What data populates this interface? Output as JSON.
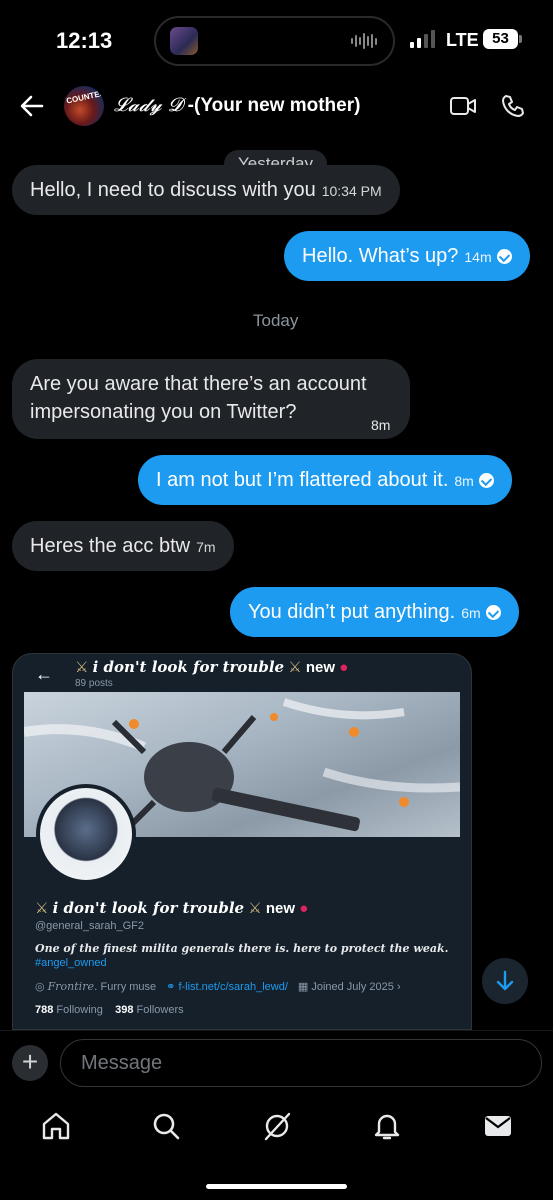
{
  "status": {
    "time": "12:13",
    "network": "LTE",
    "battery": "53"
  },
  "header": {
    "name_fancy": "𝓛𝓪𝓭𝔂 𝓓",
    "name_rest": " -(Your new mother)",
    "avatar_text": "COUNTESS"
  },
  "messages": {
    "day_yesterday": "Yesterday",
    "day_today": "Today",
    "m1": {
      "text": "Hello, I need to discuss with you",
      "time": "10:34 PM"
    },
    "m2": {
      "text": "Hello. What’s up?",
      "time": "14m"
    },
    "m3": {
      "line1": "Are you aware that there’s an account",
      "line2": "impersonating you on Twitter?",
      "time": "8m"
    },
    "m4": {
      "text": "I am not but I’m flattered about it.",
      "time": "8m"
    },
    "m5": {
      "text": "Heres the acc btw",
      "time": "7m"
    },
    "m6": {
      "text": "You didn’t put anything.",
      "time": "6m"
    }
  },
  "shared_profile": {
    "title_fancy": "𝒊 𝒅𝒐𝒏'𝒕 𝒍𝒐𝒐𝒌 𝒇𝒐𝒓 𝒕𝒓𝒐𝒖𝒃𝒍𝒆",
    "title_suffix": "new",
    "posts": "89 posts",
    "handle": "@general_sarah_GF2",
    "bio": "One of the finest milita generals there is. here to protect the weak.",
    "hashtag": "#angel_owned",
    "location": "Frontire.",
    "category": "Furry muse",
    "link": "f-list.net/c/sarah_lewd/",
    "joined": "Joined July 2025",
    "following_count": "788",
    "following_label": "Following",
    "followers_count": "398",
    "followers_label": "Followers"
  },
  "composer": {
    "placeholder": "Message"
  },
  "colors": {
    "accent": "#1d9bf0",
    "incoming_bubble": "#202327",
    "background": "#000000"
  },
  "icons": [
    "back-arrow-icon",
    "video-call-icon",
    "phone-icon",
    "plus-icon",
    "scroll-down-icon",
    "home-icon",
    "search-icon",
    "grok-icon",
    "notifications-icon",
    "messages-icon"
  ]
}
